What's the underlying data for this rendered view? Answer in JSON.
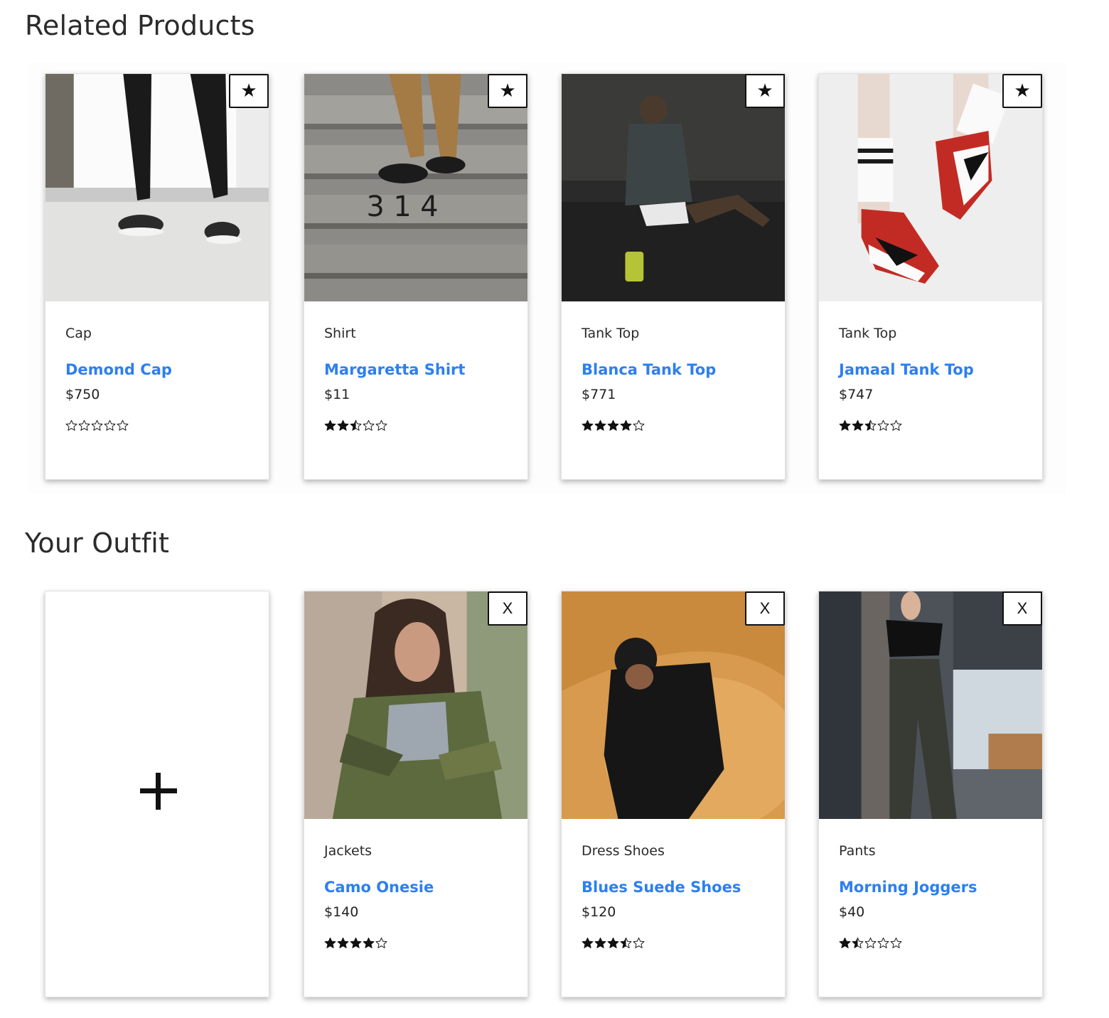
{
  "related": {
    "title": "Related Products",
    "cards": [
      {
        "category": "Cap",
        "name": "Demond Cap",
        "price": "$750",
        "rating": 0,
        "action": "★"
      },
      {
        "category": "Shirt",
        "name": "Margaretta Shirt",
        "price": "$11",
        "rating": 2.5,
        "action": "★"
      },
      {
        "category": "Tank Top",
        "name": "Blanca Tank Top",
        "price": "$771",
        "rating": 4,
        "action": "★"
      },
      {
        "category": "Tank Top",
        "name": "Jamaal Tank Top",
        "price": "$747",
        "rating": 2.5,
        "action": "★"
      }
    ]
  },
  "outfit": {
    "title": "Your Outfit",
    "add_label": "+",
    "cards": [
      {
        "category": "Jackets",
        "name": "Camo Onesie",
        "price": "$140",
        "rating": 4,
        "action": "X"
      },
      {
        "category": "Dress Shoes",
        "name": "Blues Suede Shoes",
        "price": "$120",
        "rating": 3.5,
        "action": "X"
      },
      {
        "category": "Pants",
        "name": "Morning Joggers",
        "price": "$40",
        "rating": 1.5,
        "action": "X"
      }
    ]
  },
  "colors": {
    "link": "#2d7ff0",
    "star": "#111111"
  }
}
